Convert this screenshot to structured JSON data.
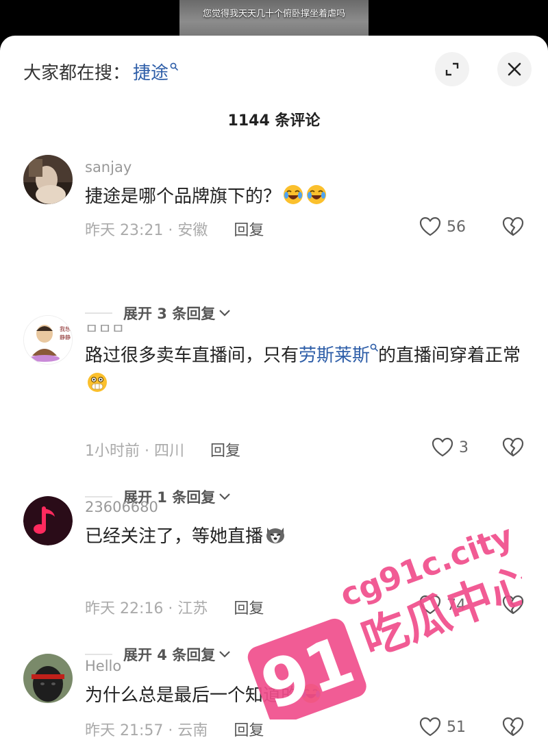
{
  "video": {
    "caption": "您觉得我天天几十个俯卧撑坐着虐吗"
  },
  "search": {
    "prefix": "大家都在搜：",
    "term": "捷途"
  },
  "header": {
    "comment_count": "1144 条评论"
  },
  "comments": [
    {
      "username": "sanjay",
      "text_parts": [
        "捷途是哪个品牌旗下的？",
        "",
        ""
      ],
      "meta": "昨天 23:21 · 安徽",
      "reply": "回复",
      "likes": "56",
      "expand": "展开 3 条回复"
    },
    {
      "username": "ㅁㅁㅁ",
      "text_parts": [
        "路过很多卖车直播间，只有",
        "劳斯莱斯",
        "的直播间穿着正常"
      ],
      "meta": "1小时前 · 四川",
      "reply": "回复",
      "likes": "3",
      "expand": "展开 1 条回复"
    },
    {
      "username": "23606680",
      "text_parts": [
        "已经关注了，等她直播",
        "",
        ""
      ],
      "meta": "昨天 22:16 · 江苏",
      "reply": "回复",
      "likes": "74",
      "expand": "展开 4 条回复"
    },
    {
      "username": "Hello",
      "text_parts": [
        "为什么总是最后一个知道的",
        "",
        ""
      ],
      "meta": "昨天 21:57 · 云南",
      "reply": "回复",
      "likes": "51",
      "expand": ""
    }
  ],
  "watermark": {
    "number": "91",
    "domain": "cg91c.city",
    "text": "吃瓜中心"
  },
  "colors": {
    "link": "#2e5ea8",
    "muted": "#999999",
    "watermark": "#f04e8c"
  },
  "icons": [
    "search-icon",
    "expand-icon",
    "close-icon",
    "heart-icon",
    "broken-heart-icon",
    "chevron-down-icon",
    "laughing-emoji",
    "shushing-emoji",
    "husky-emoji"
  ]
}
